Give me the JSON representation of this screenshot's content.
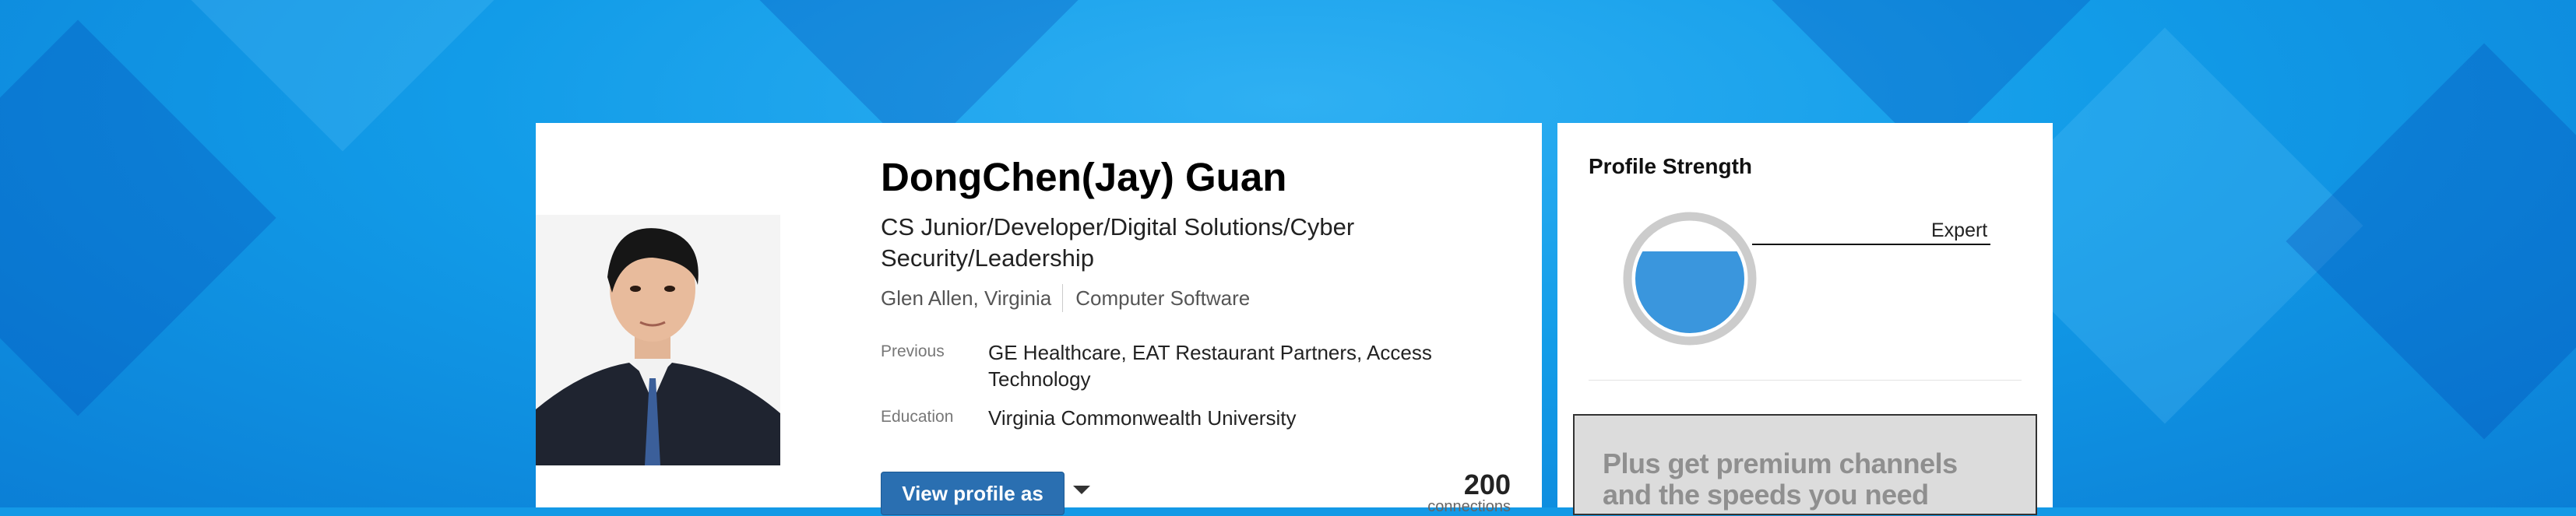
{
  "profile": {
    "name": "DongChen(Jay) Guan",
    "headline": "CS Junior/Developer/Digital Solutions/Cyber Security/Leadership",
    "location": "Glen Allen, Virginia",
    "industry": "Computer Software",
    "previous_label": "Previous",
    "previous_value": "GE Healthcare, EAT Restaurant Partners, Access Technology",
    "education_label": "Education",
    "education_value": "Virginia Commonwealth University",
    "view_profile_button": "View profile as",
    "connections_count": "200",
    "connections_label": "connections"
  },
  "sidebar": {
    "profile_strength_title": "Profile Strength",
    "strength_level": "Expert",
    "strength_fill_fraction": 0.75,
    "ad_text": "Plus get premium channels and the speeds you need"
  },
  "colors": {
    "background_blue": "#1499e6",
    "button_blue": "#2a6fb1",
    "gauge_fill": "#3a96dd",
    "gauge_ring": "#cccccc"
  },
  "icons": {
    "dropdown": "caret-down-icon"
  }
}
